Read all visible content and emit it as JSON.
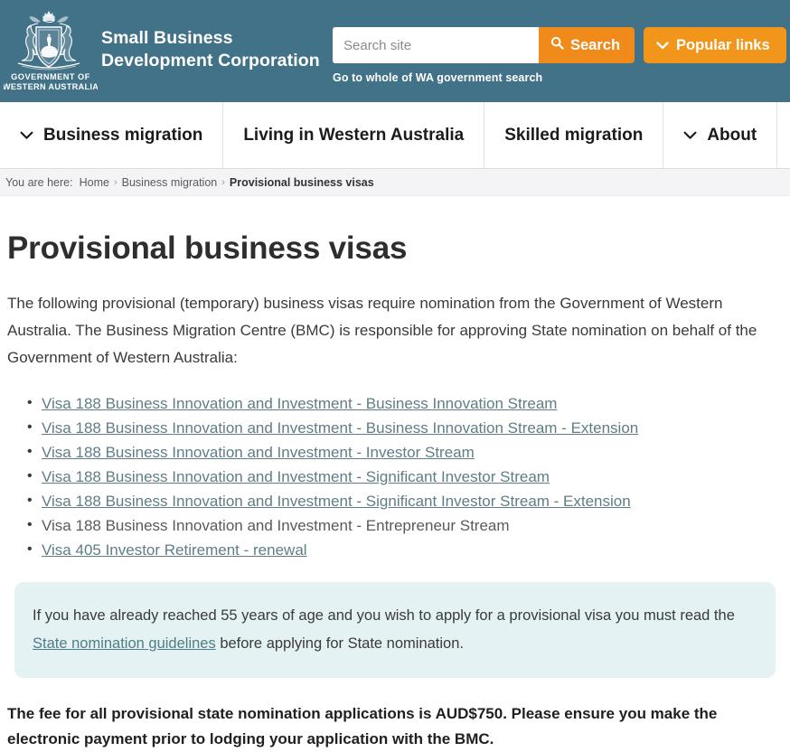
{
  "header": {
    "crest": {
      "icon": "wa-coat-of-arms",
      "line1": "GOVERNMENT OF",
      "line2": "WESTERN AUSTRALIA"
    },
    "brand_line1": "Small Business",
    "brand_line2": "Development Corporation",
    "search": {
      "placeholder": "Search site",
      "value": "",
      "button_label": "Search",
      "button_icon": "search-icon"
    },
    "popular_links": {
      "label": "Popular links",
      "icon": "chevron-down-icon"
    },
    "wa_gov_search_link": "Go to whole of WA government search",
    "background_color": "#417287",
    "accent_color": "#f2951b"
  },
  "nav": {
    "items": [
      {
        "label": "Business migration",
        "has_chevron": true,
        "icon": "chevron-down-icon"
      },
      {
        "label": "Living in Western Australia",
        "has_chevron": false,
        "icon": ""
      },
      {
        "label": "Skilled migration",
        "has_chevron": false,
        "icon": ""
      },
      {
        "label": "About",
        "has_chevron": true,
        "icon": "chevron-down-icon"
      }
    ]
  },
  "breadcrumb": {
    "label": "You are here:",
    "separator": "›",
    "items": [
      {
        "label": "Home",
        "current": false
      },
      {
        "label": "Business migration",
        "current": false
      },
      {
        "label": "Provisional business visas",
        "current": true
      }
    ]
  },
  "main": {
    "title": "Provisional business visas",
    "intro": "The following provisional (temporary) business visas require nomination from the Government of Western Australia. The Business Migration Centre (BMC) is responsible for approving State nomination on behalf of the Government of Western Australia:",
    "visa_list": [
      {
        "text": "Visa 188 Business Innovation and Investment - Business Innovation Stream",
        "is_link": true
      },
      {
        "text": "Visa 188 Business Innovation and Investment - Business Innovation Stream - Extension",
        "is_link": true
      },
      {
        "text": "Visa 188 Business Innovation and Investment - Investor Stream",
        "is_link": true
      },
      {
        "text": "Visa 188 Business Innovation and Investment - Significant Investor Stream",
        "is_link": true
      },
      {
        "text": "Visa 188 Business Innovation and Investment - Significant Investor Stream - Extension",
        "is_link": true
      },
      {
        "text": "Visa 188 Business Innovation and Investment - Entrepreneur Stream",
        "is_link": false
      },
      {
        "text": "Visa 405 Investor Retirement - renewal",
        "is_link": true
      }
    ],
    "callout": {
      "text_before": "If you have already reached 55 years of age and you wish to apply for a provisional visa you must read the ",
      "link_text": "State nomination guidelines",
      "text_after": " before applying for State nomination.",
      "background_color": "#e4f2f3"
    },
    "fee_note": "The fee for all provisional state nomination applications is AUD$750. Please ensure you make the electronic payment prior to lodging your application with the BMC."
  }
}
